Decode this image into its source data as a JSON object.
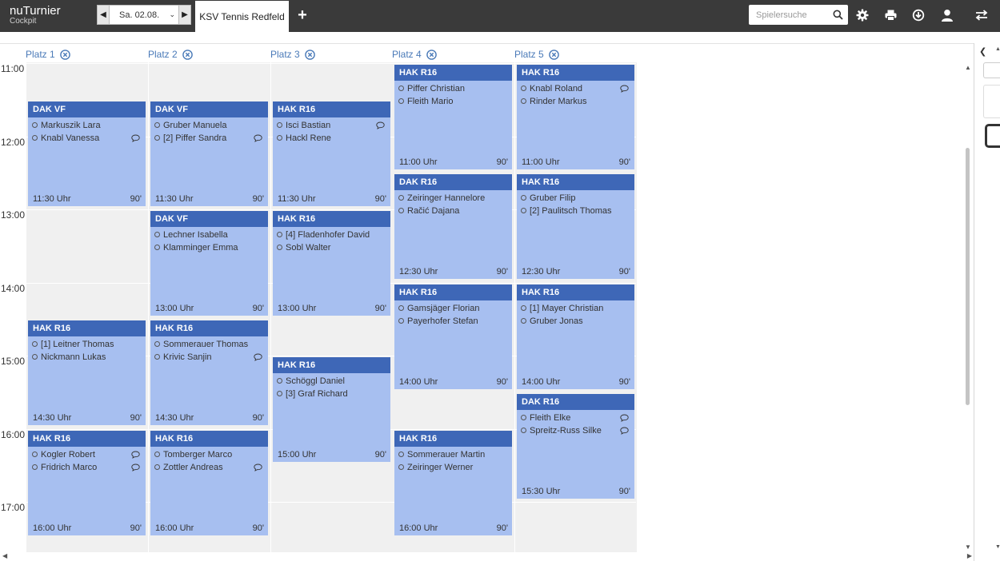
{
  "app": {
    "name": "nuTurnier",
    "subtitle": "Cockpit"
  },
  "date_selector": {
    "value": "Sa. 02.08."
  },
  "tab": {
    "label": "KSV Tennis Redfeld"
  },
  "search": {
    "placeholder": "Spielersuche"
  },
  "icons": {
    "search": "search-icon",
    "settings": "gear-icon",
    "print": "print-icon",
    "download": "download-icon",
    "user": "user-icon",
    "switch": "swap-arrows-icon"
  },
  "colors": {
    "topbar": "#3a3a3a",
    "match_header": "#3e67b7",
    "match_body": "#a7bff0",
    "court_label": "#4a7ab8"
  },
  "courts": [
    {
      "label": "Platz 1"
    },
    {
      "label": "Platz 2"
    },
    {
      "label": "Platz 3"
    },
    {
      "label": "Platz 4"
    },
    {
      "label": "Platz 5"
    }
  ],
  "times": [
    "11:00",
    "12:00",
    "13:00",
    "14:00",
    "15:00",
    "16:00",
    "17:00"
  ],
  "matches": [
    {
      "court": 0,
      "start": 11.5,
      "title": "DAK VF",
      "players": [
        {
          "name": "Markuszik Lara",
          "comment": false
        },
        {
          "name": "Knabl Vanessa",
          "comment": true
        }
      ],
      "time": "11:30 Uhr",
      "duration": "90'"
    },
    {
      "court": 0,
      "start": 14.5,
      "title": "HAK R16",
      "players": [
        {
          "name": "[1] Leitner Thomas",
          "comment": false
        },
        {
          "name": "Nickmann Lukas",
          "comment": false
        }
      ],
      "time": "14:30 Uhr",
      "duration": "90'"
    },
    {
      "court": 0,
      "start": 16.0,
      "title": "HAK R16",
      "players": [
        {
          "name": "Kogler Robert",
          "comment": true
        },
        {
          "name": "Fridrich Marco",
          "comment": true
        }
      ],
      "time": "16:00 Uhr",
      "duration": "90'"
    },
    {
      "court": 1,
      "start": 11.5,
      "title": "DAK VF",
      "players": [
        {
          "name": "Gruber Manuela",
          "comment": false
        },
        {
          "name": "[2] Piffer Sandra",
          "comment": true
        }
      ],
      "time": "11:30 Uhr",
      "duration": "90'"
    },
    {
      "court": 1,
      "start": 13.0,
      "title": "DAK VF",
      "players": [
        {
          "name": "Lechner Isabella",
          "comment": false
        },
        {
          "name": "Klamminger Emma",
          "comment": false
        }
      ],
      "time": "13:00 Uhr",
      "duration": "90'"
    },
    {
      "court": 1,
      "start": 14.5,
      "title": "HAK R16",
      "players": [
        {
          "name": "Sommerauer Thomas",
          "comment": false
        },
        {
          "name": "Krivic Sanjin",
          "comment": true
        }
      ],
      "time": "14:30 Uhr",
      "duration": "90'"
    },
    {
      "court": 1,
      "start": 16.0,
      "title": "HAK R16",
      "players": [
        {
          "name": "Tomberger Marco",
          "comment": false
        },
        {
          "name": "Zottler Andreas",
          "comment": true
        }
      ],
      "time": "16:00 Uhr",
      "duration": "90'"
    },
    {
      "court": 2,
      "start": 11.5,
      "title": "HAK R16",
      "players": [
        {
          "name": "Isci Bastian",
          "comment": true
        },
        {
          "name": "Hackl Rene",
          "comment": false
        }
      ],
      "time": "11:30 Uhr",
      "duration": "90'"
    },
    {
      "court": 2,
      "start": 13.0,
      "title": "HAK R16",
      "players": [
        {
          "name": "[4] Fladenhofer David",
          "comment": false
        },
        {
          "name": "Sobl Walter",
          "comment": false
        }
      ],
      "time": "13:00 Uhr",
      "duration": "90'"
    },
    {
      "court": 2,
      "start": 15.0,
      "title": "HAK R16",
      "players": [
        {
          "name": "Schöggl Daniel",
          "comment": false
        },
        {
          "name": "[3] Graf Richard",
          "comment": false
        }
      ],
      "time": "15:00 Uhr",
      "duration": "90'"
    },
    {
      "court": 3,
      "start": 11.0,
      "title": "HAK R16",
      "players": [
        {
          "name": "Piffer Christian",
          "comment": false
        },
        {
          "name": "Fleith Mario",
          "comment": false
        }
      ],
      "time": "11:00 Uhr",
      "duration": "90'"
    },
    {
      "court": 3,
      "start": 12.5,
      "title": "DAK R16",
      "players": [
        {
          "name": "Zeiringer Hannelore",
          "comment": false
        },
        {
          "name": "Račić Dajana",
          "comment": false
        }
      ],
      "time": "12:30 Uhr",
      "duration": "90'"
    },
    {
      "court": 3,
      "start": 14.0,
      "title": "HAK R16",
      "players": [
        {
          "name": "Gamsjäger Florian",
          "comment": false
        },
        {
          "name": "Payerhofer Stefan",
          "comment": false
        }
      ],
      "time": "14:00 Uhr",
      "duration": "90'"
    },
    {
      "court": 3,
      "start": 16.0,
      "title": "HAK R16",
      "players": [
        {
          "name": "Sommerauer Martin",
          "comment": false
        },
        {
          "name": "Zeiringer Werner",
          "comment": false
        }
      ],
      "time": "16:00 Uhr",
      "duration": "90'"
    },
    {
      "court": 4,
      "start": 11.0,
      "title": "HAK R16",
      "players": [
        {
          "name": "Knabl Roland",
          "comment": true
        },
        {
          "name": "Rinder Markus",
          "comment": false
        }
      ],
      "time": "11:00 Uhr",
      "duration": "90'"
    },
    {
      "court": 4,
      "start": 12.5,
      "title": "HAK R16",
      "players": [
        {
          "name": "Gruber Filip",
          "comment": false
        },
        {
          "name": "[2] Paulitsch Thomas",
          "comment": false
        }
      ],
      "time": "12:30 Uhr",
      "duration": "90'"
    },
    {
      "court": 4,
      "start": 14.0,
      "title": "HAK R16",
      "players": [
        {
          "name": "[1] Mayer Christian",
          "comment": false
        },
        {
          "name": "Gruber Jonas",
          "comment": false
        }
      ],
      "time": "14:00 Uhr",
      "duration": "90'"
    },
    {
      "court": 4,
      "start": 15.5,
      "title": "DAK R16",
      "players": [
        {
          "name": "Fleith Elke",
          "comment": true
        },
        {
          "name": "Spreitz-Russ Silke",
          "comment": true
        }
      ],
      "time": "15:30 Uhr",
      "duration": "90'"
    }
  ]
}
